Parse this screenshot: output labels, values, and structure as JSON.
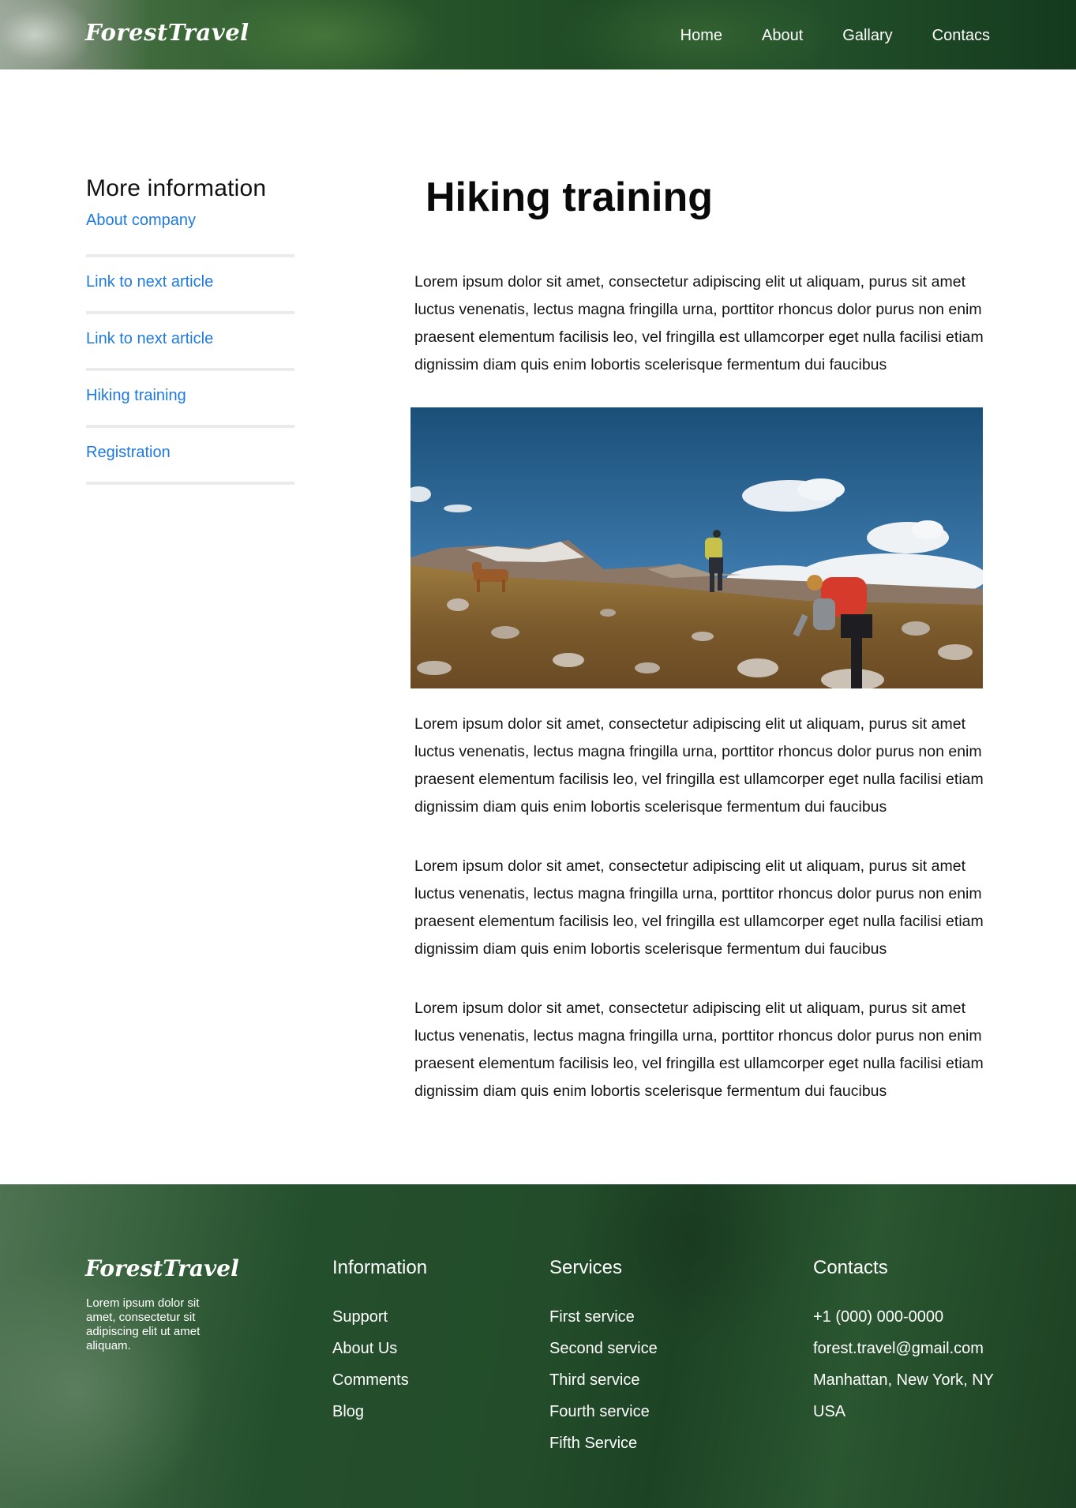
{
  "header": {
    "logo": "ForestTravel",
    "nav": [
      "Home",
      "About",
      "Gallary",
      "Contacs"
    ]
  },
  "sidebar": {
    "title": "More information",
    "items": [
      {
        "label": "About company"
      },
      {
        "label": "Link to next article"
      },
      {
        "label": "Link to next article"
      },
      {
        "label": "Hiking training"
      },
      {
        "label": "Registration"
      }
    ]
  },
  "article": {
    "title": "Hiking training",
    "paragraphs": [
      "Lorem ipsum dolor sit amet, consectetur adipiscing elit ut aliquam, purus sit amet luctus venenatis, lectus magna fringilla urna, porttitor rhoncus dolor purus non enim praesent elementum facilisis leo, vel fringilla est ullamcorper eget nulla facilisi etiam dignissim diam quis enim lobortis scelerisque fermentum dui faucibus",
      "Lorem ipsum dolor sit amet, consectetur adipiscing elit ut aliquam, purus sit amet luctus venenatis, lectus magna fringilla urna, porttitor rhoncus dolor purus non enim praesent elementum facilisis leo, vel fringilla est ullamcorper eget nulla facilisi etiam dignissim diam quis enim lobortis scelerisque fermentum dui faucibus",
      "Lorem ipsum dolor sit amet, consectetur adipiscing elit ut aliquam, purus sit amet luctus venenatis, lectus magna fringilla urna, porttitor rhoncus dolor purus non enim praesent elementum facilisis leo, vel fringilla est ullamcorper eget nulla facilisi etiam dignissim diam quis enim lobortis scelerisque fermentum dui faucibus",
      "Lorem ipsum dolor sit amet, consectetur adipiscing elit ut aliquam, purus sit amet luctus venenatis, lectus magna fringilla urna, porttitor rhoncus dolor purus non enim praesent elementum facilisis leo, vel fringilla est ullamcorper eget nulla facilisi etiam dignissim diam quis enim lobortis scelerisque fermentum dui faucibus"
    ]
  },
  "footer": {
    "logo": "ForestTravel",
    "description": "Lorem ipsum dolor sit amet, consectetur sit adipiscing elit ut amet aliquam.",
    "information": {
      "title": "Information",
      "items": [
        "Support",
        "About Us",
        "Comments",
        "Blog"
      ]
    },
    "services": {
      "title": "Services",
      "items": [
        "First service",
        "Second service",
        "Third service",
        "Fourth service",
        "Fifth Service"
      ]
    },
    "contacts": {
      "title": "Contacts",
      "items": [
        "+1 (000) 000-0000",
        "forest.travel@gmail.com",
        "Manhattan, New York, NY",
        "USA"
      ]
    }
  },
  "colors": {
    "link": "#1f7ae0",
    "divider": "#ebebeb",
    "forest_green": "#234d2a"
  }
}
